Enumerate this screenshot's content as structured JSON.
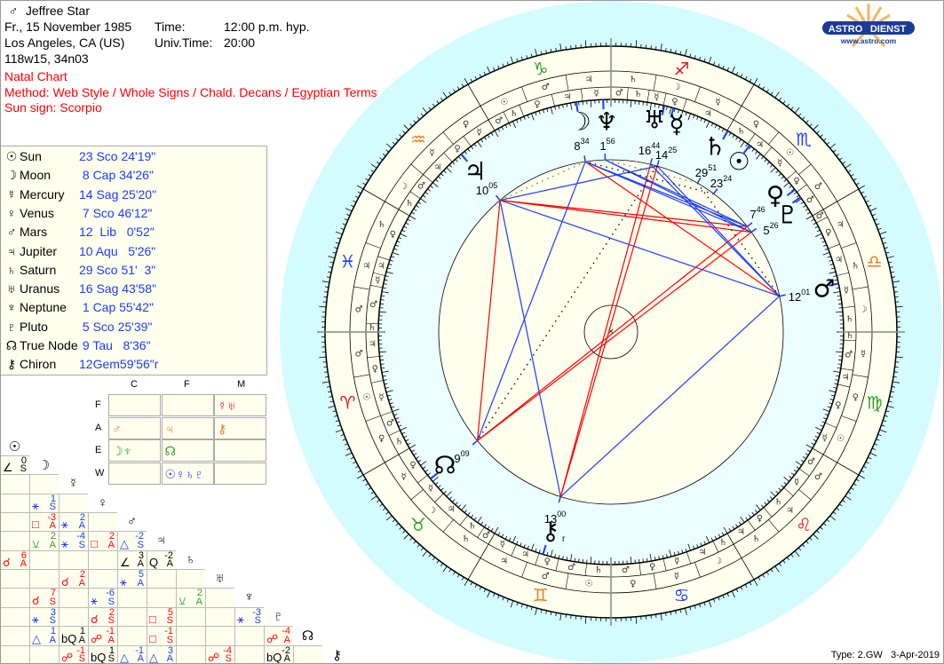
{
  "header": {
    "gender_icon": "♂",
    "name": "Jeffree Star",
    "date": "Fr., 15 November 1985",
    "time_label": "Time:",
    "time": "12:00 p.m. hyp.",
    "place": "Los Angeles, CA (US)",
    "ut_label": "Univ.Time:",
    "ut": "20:00",
    "coords": "118w15, 34n03",
    "chart_type": "Natal Chart",
    "method": "Method: Web Style / Whole Signs / Chald. Decans / Egyptian Terms",
    "sun_sign": "Sun sign: Scorpio"
  },
  "logo": {
    "left": "ASTRO",
    "right": "DIENST",
    "url": "www.astro.com",
    "brand_color": "#1a3b96",
    "sun_color": "#f7b55a"
  },
  "planets": [
    {
      "glyph": "☉",
      "name": "Sun",
      "pos": "23 Sco 24'19\"",
      "lon": 233.405,
      "deg": "23",
      "min": "24"
    },
    {
      "glyph": "☽",
      "name": "Moon",
      "pos": " 8 Cap 34'26\"",
      "lon": 278.574,
      "deg": "8",
      "min": "34"
    },
    {
      "glyph": "☿",
      "name": "Mercury",
      "pos": "14 Sag 25'20\"",
      "lon": 254.422,
      "deg": "14",
      "min": "25"
    },
    {
      "glyph": "♀",
      "name": "Venus",
      "pos": " 7 Sco 46'12\"",
      "lon": 217.77,
      "deg": "7",
      "min": "46"
    },
    {
      "glyph": "♂",
      "name": "Mars",
      "pos": "12  Lib   0'52\"",
      "lon": 192.014,
      "deg": "12",
      "min": "01"
    },
    {
      "glyph": "♃",
      "name": "Jupiter",
      "pos": "10 Aqu   5'26\"",
      "lon": 310.091,
      "deg": "10",
      "min": "05"
    },
    {
      "glyph": "♄",
      "name": "Saturn",
      "pos": "29 Sco 51'  3\"",
      "lon": 239.851,
      "deg": "29",
      "min": "51"
    },
    {
      "glyph": "♅",
      "name": "Uranus",
      "pos": "16 Sag 43'58\"",
      "lon": 256.733,
      "deg": "16",
      "min": "44"
    },
    {
      "glyph": "♆",
      "name": "Neptune",
      "pos": " 1 Cap 55'42\"",
      "lon": 271.928,
      "deg": "1",
      "min": "56"
    },
    {
      "glyph": "♇",
      "name": "Pluto",
      "pos": " 5 Sco 25'39\"",
      "lon": 215.428,
      "deg": "5",
      "min": "26"
    },
    {
      "glyph": "☊",
      "name": "True Node",
      "pos": " 9 Tau   8'36\"",
      "lon": 39.143,
      "deg": "9",
      "min": "09"
    },
    {
      "glyph": "⚷",
      "name": "Chiron",
      "pos": "12Gem59'56\"r",
      "lon": 72.999,
      "deg": "13",
      "min": "00",
      "retro": "r"
    }
  ],
  "elements": {
    "col_headers": [
      "C",
      "F",
      "M"
    ],
    "row_headers": [
      "F",
      "A",
      "E",
      "W"
    ],
    "cells": [
      [
        {
          "g": "",
          "c": ""
        },
        {
          "g": "",
          "c": ""
        },
        {
          "g": "☿♅",
          "c": "#e8141e"
        }
      ],
      [
        {
          "g": "♂",
          "c": "#f07820"
        },
        {
          "g": "♃",
          "c": "#f07820"
        },
        {
          "g": "⚷",
          "c": "#f07820"
        }
      ],
      [
        {
          "g": "☽♆",
          "c": "#2ca02c"
        },
        {
          "g": "☊",
          "c": "#2ca02c"
        },
        {
          "g": "",
          "c": ""
        }
      ],
      [
        {
          "g": "",
          "c": ""
        },
        {
          "g": "☉♀♄♇",
          "c": "#1a3cff"
        },
        {
          "g": "",
          "c": ""
        }
      ]
    ]
  },
  "aspect_colors": {
    "r": "#f00",
    "b": "#1a3cff",
    "g": "#2ca02c",
    "k": "#000"
  },
  "aspect_grid": [
    [
      {
        "s": "∠",
        "o": "0",
        "t": "S",
        "c": "k"
      }
    ],
    [
      null,
      null
    ],
    [
      null,
      {
        "s": "⚹",
        "o": "1",
        "t": "S",
        "c": "b"
      },
      null
    ],
    [
      null,
      {
        "s": "□",
        "o": "-3",
        "t": "A",
        "c": "r"
      },
      {
        "s": "⚹",
        "o": "2",
        "t": "A",
        "c": "b"
      },
      null
    ],
    [
      null,
      {
        "s": "⚺",
        "o": "2",
        "t": "A",
        "c": "g"
      },
      {
        "s": "⚹",
        "o": "-4",
        "t": "S",
        "c": "b"
      },
      {
        "s": "□",
        "o": "2",
        "t": "A",
        "c": "r"
      },
      {
        "s": "△",
        "o": "-2",
        "t": "S",
        "c": "b"
      }
    ],
    [
      {
        "s": "☌",
        "o": "6",
        "t": "A",
        "c": "r"
      },
      null,
      null,
      null,
      {
        "s": "∠",
        "o": "3",
        "t": "A",
        "c": "k"
      },
      {
        "s": "Q",
        "o": "-2",
        "t": "A",
        "c": "k"
      }
    ],
    [
      null,
      null,
      {
        "s": "☌",
        "o": "2",
        "t": "A",
        "c": "r"
      },
      null,
      {
        "s": "⚹",
        "o": "5",
        "t": "A",
        "c": "b"
      },
      null,
      null
    ],
    [
      null,
      {
        "s": "☌",
        "o": "7",
        "t": "S",
        "c": "r"
      },
      null,
      {
        "s": "⚹",
        "o": "-6",
        "t": "S",
        "c": "b"
      },
      null,
      null,
      {
        "s": "⚺",
        "o": "2",
        "t": "A",
        "c": "g"
      },
      null
    ],
    [
      null,
      {
        "s": "⚹",
        "o": "3",
        "t": "S",
        "c": "b"
      },
      null,
      {
        "s": "☌",
        "o": "2",
        "t": "S",
        "c": "r"
      },
      null,
      {
        "s": "□",
        "o": "5",
        "t": "S",
        "c": "r"
      },
      null,
      null,
      {
        "s": "⚹",
        "o": "-3",
        "t": "S",
        "c": "b"
      }
    ],
    [
      null,
      {
        "s": "△",
        "o": "1",
        "t": "A",
        "c": "b"
      },
      {
        "s": "bQ",
        "o": "1",
        "t": "A",
        "c": "k"
      },
      {
        "s": "☍",
        "o": "-1",
        "t": "A",
        "c": "r"
      },
      null,
      {
        "s": "□",
        "o": "-1",
        "t": "S",
        "c": "r"
      },
      null,
      null,
      null,
      {
        "s": "☍",
        "o": "-4",
        "t": "A",
        "c": "r"
      }
    ],
    [
      null,
      null,
      {
        "s": "☍",
        "o": "-1",
        "t": "S",
        "c": "r"
      },
      {
        "s": "bQ",
        "o": "1",
        "t": "S",
        "c": "k"
      },
      {
        "s": "△",
        "o": "-1",
        "t": "A",
        "c": "b"
      },
      {
        "s": "△",
        "o": "3",
        "t": "A",
        "c": "b"
      },
      null,
      {
        "s": "☍",
        "o": "-4",
        "t": "S",
        "c": "r"
      },
      null,
      {
        "s": "bQ",
        "o": "-2",
        "t": "A",
        "c": "k"
      },
      null
    ]
  ],
  "wheel": {
    "signs": [
      {
        "glyph": "♈",
        "color": "#e8141e"
      },
      {
        "glyph": "♉",
        "color": "#2ca02c"
      },
      {
        "glyph": "♊",
        "color": "#f07820"
      },
      {
        "glyph": "♋",
        "color": "#1a3cff"
      },
      {
        "glyph": "♌",
        "color": "#e8141e"
      },
      {
        "glyph": "♍",
        "color": "#2ca02c"
      },
      {
        "glyph": "♎",
        "color": "#f07820"
      },
      {
        "glyph": "♏",
        "color": "#1a3cff"
      },
      {
        "glyph": "♐",
        "color": "#e8141e"
      },
      {
        "glyph": "♑",
        "color": "#2ca02c"
      },
      {
        "glyph": "♒",
        "color": "#f07820"
      },
      {
        "glyph": "♓",
        "color": "#1a3cff"
      }
    ],
    "decans": [
      "♂",
      "☉",
      "♀",
      "☿",
      "☽",
      "♄",
      "♃",
      "♂",
      "☉",
      "♀",
      "☿",
      "☽",
      "♄",
      "♃",
      "♂",
      "☉",
      "♀",
      "☿",
      "☽",
      "♄",
      "♃",
      "♂",
      "☉",
      "♀",
      "☿",
      "☽",
      "♄",
      "♃",
      "♂",
      "☉",
      "♀",
      "☿",
      "☽",
      "♄",
      "♃",
      "♂"
    ],
    "terms": [
      [
        [
          "♃",
          6
        ],
        [
          "♀",
          12
        ],
        [
          "☿",
          20
        ],
        [
          "♂",
          25
        ],
        [
          "♄",
          30
        ]
      ],
      [
        [
          "♀",
          8
        ],
        [
          "☿",
          14
        ],
        [
          "♃",
          22
        ],
        [
          "♄",
          27
        ],
        [
          "♂",
          30
        ]
      ],
      [
        [
          "☿",
          6
        ],
        [
          "♃",
          12
        ],
        [
          "♀",
          17
        ],
        [
          "♂",
          24
        ],
        [
          "♄",
          30
        ]
      ],
      [
        [
          "♂",
          7
        ],
        [
          "♀",
          13
        ],
        [
          "☿",
          19
        ],
        [
          "♃",
          26
        ],
        [
          "♄",
          30
        ]
      ],
      [
        [
          "♃",
          6
        ],
        [
          "♀",
          11
        ],
        [
          "♄",
          18
        ],
        [
          "☿",
          24
        ],
        [
          "♂",
          30
        ]
      ],
      [
        [
          "☿",
          7
        ],
        [
          "♀",
          17
        ],
        [
          "♃",
          21
        ],
        [
          "♂",
          28
        ],
        [
          "♄",
          30
        ]
      ],
      [
        [
          "♄",
          6
        ],
        [
          "☿",
          14
        ],
        [
          "♃",
          21
        ],
        [
          "♀",
          28
        ],
        [
          "♂",
          30
        ]
      ],
      [
        [
          "♂",
          7
        ],
        [
          "♀",
          11
        ],
        [
          "☿",
          19
        ],
        [
          "♃",
          24
        ],
        [
          "♄",
          30
        ]
      ],
      [
        [
          "♃",
          12
        ],
        [
          "♀",
          17
        ],
        [
          "☿",
          21
        ],
        [
          "♄",
          26
        ],
        [
          "♂",
          30
        ]
      ],
      [
        [
          "☿",
          7
        ],
        [
          "♃",
          14
        ],
        [
          "♀",
          22
        ],
        [
          "♄",
          26
        ],
        [
          "♂",
          30
        ]
      ],
      [
        [
          "☿",
          7
        ],
        [
          "♀",
          13
        ],
        [
          "♃",
          20
        ],
        [
          "♂",
          25
        ],
        [
          "♄",
          30
        ]
      ],
      [
        [
          "♀",
          12
        ],
        [
          "♃",
          16
        ],
        [
          "☿",
          19
        ],
        [
          "♂",
          28
        ],
        [
          "♄",
          30
        ]
      ]
    ],
    "aspect_lines": [
      {
        "a": 1,
        "b": 3,
        "c": "b"
      },
      {
        "a": 1,
        "b": 4,
        "c": "r"
      },
      {
        "a": 2,
        "b": 4,
        "c": "b"
      },
      {
        "a": 2,
        "b": 5,
        "c": "b"
      },
      {
        "a": 3,
        "b": 5,
        "c": "r"
      },
      {
        "a": 4,
        "b": 5,
        "c": "b"
      },
      {
        "a": 4,
        "b": 7,
        "c": "b"
      },
      {
        "a": 3,
        "b": 8,
        "c": "b"
      },
      {
        "a": 1,
        "b": 9,
        "c": "b"
      },
      {
        "a": 5,
        "b": 9,
        "c": "r"
      },
      {
        "a": 8,
        "b": 9,
        "c": "b"
      },
      {
        "a": 1,
        "b": 10,
        "c": "b"
      },
      {
        "a": 3,
        "b": 10,
        "c": "r"
      },
      {
        "a": 5,
        "b": 10,
        "c": "r"
      },
      {
        "a": 9,
        "b": 10,
        "c": "r"
      },
      {
        "a": 2,
        "b": 11,
        "c": "r"
      },
      {
        "a": 4,
        "b": 11,
        "c": "b"
      },
      {
        "a": 5,
        "b": 11,
        "c": "b"
      },
      {
        "a": 7,
        "b": 11,
        "c": "r"
      },
      {
        "a": 1,
        "b": 5,
        "c": "g",
        "dotted": true
      },
      {
        "a": 6,
        "b": 8,
        "c": "g",
        "dotted": true
      },
      {
        "a": 0,
        "b": 1,
        "c": "k",
        "dotted": true
      },
      {
        "a": 4,
        "b": 6,
        "c": "k",
        "dotted": true
      },
      {
        "a": 2,
        "b": 10,
        "c": "k",
        "dotted": true
      }
    ]
  },
  "footer": {
    "type": "Type: 2.GW",
    "date": "3-Apr-2019"
  }
}
